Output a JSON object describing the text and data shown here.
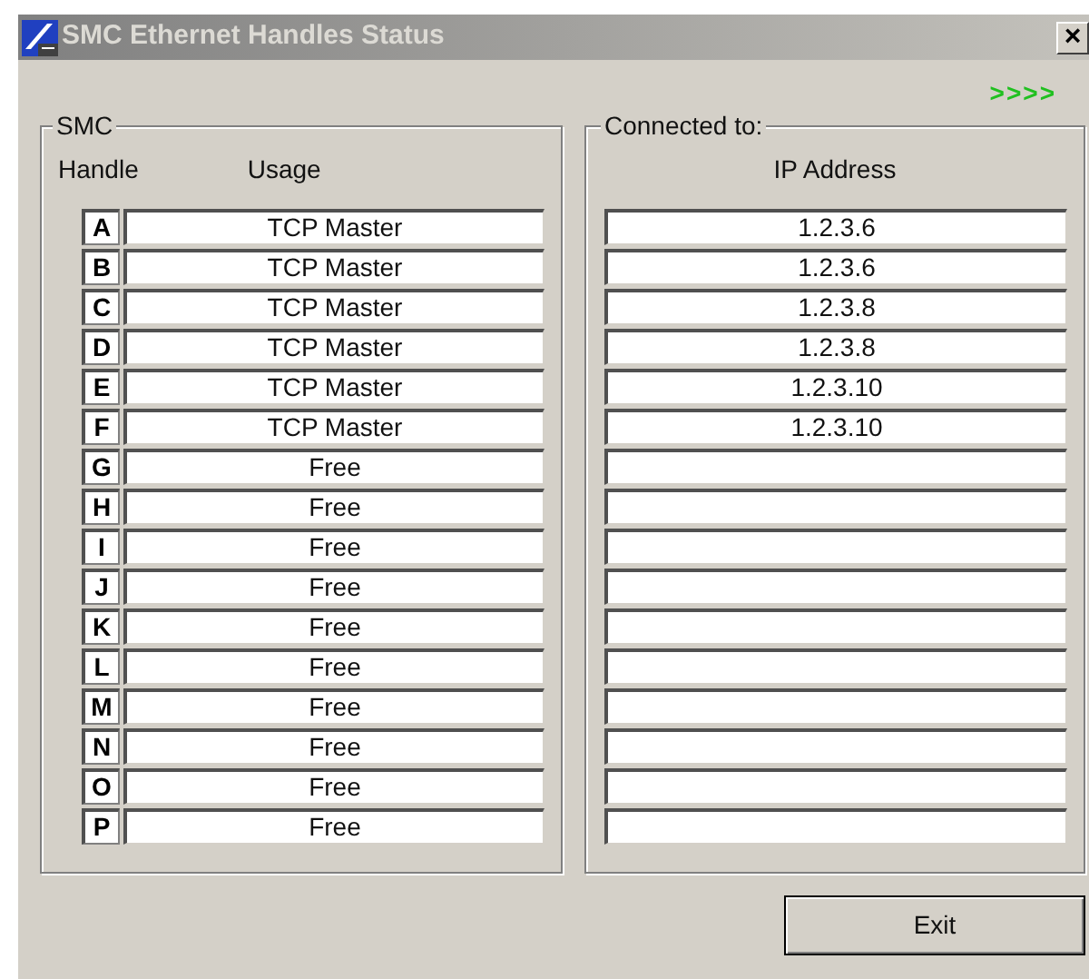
{
  "window": {
    "title": "SMC Ethernet Handles Status",
    "close": "×"
  },
  "indicator": ">>>>",
  "smc_group": {
    "label": "SMC",
    "handle_header": "Handle",
    "usage_header": "Usage"
  },
  "connected_group": {
    "label": "Connected to:",
    "ip_header": "IP Address"
  },
  "rows": [
    {
      "handle": "A",
      "usage": "TCP Master",
      "ip": "1.2.3.6"
    },
    {
      "handle": "B",
      "usage": "TCP Master",
      "ip": "1.2.3.6"
    },
    {
      "handle": "C",
      "usage": "TCP Master",
      "ip": "1.2.3.8"
    },
    {
      "handle": "D",
      "usage": "TCP Master",
      "ip": "1.2.3.8"
    },
    {
      "handle": "E",
      "usage": "TCP Master",
      "ip": "1.2.3.10"
    },
    {
      "handle": "F",
      "usage": "TCP Master",
      "ip": "1.2.3.10"
    },
    {
      "handle": "G",
      "usage": "Free"
    },
    {
      "handle": "H",
      "usage": "Free"
    },
    {
      "handle": "I",
      "usage": "Free"
    },
    {
      "handle": "J",
      "usage": "Free"
    },
    {
      "handle": "K",
      "usage": "Free"
    },
    {
      "handle": "L",
      "usage": "Free"
    },
    {
      "handle": "M",
      "usage": "Free"
    },
    {
      "handle": "N",
      "usage": "Free"
    },
    {
      "handle": "O",
      "usage": "Free"
    },
    {
      "handle": "P",
      "usage": "Free"
    }
  ],
  "buttons": [
    "Exit"
  ]
}
